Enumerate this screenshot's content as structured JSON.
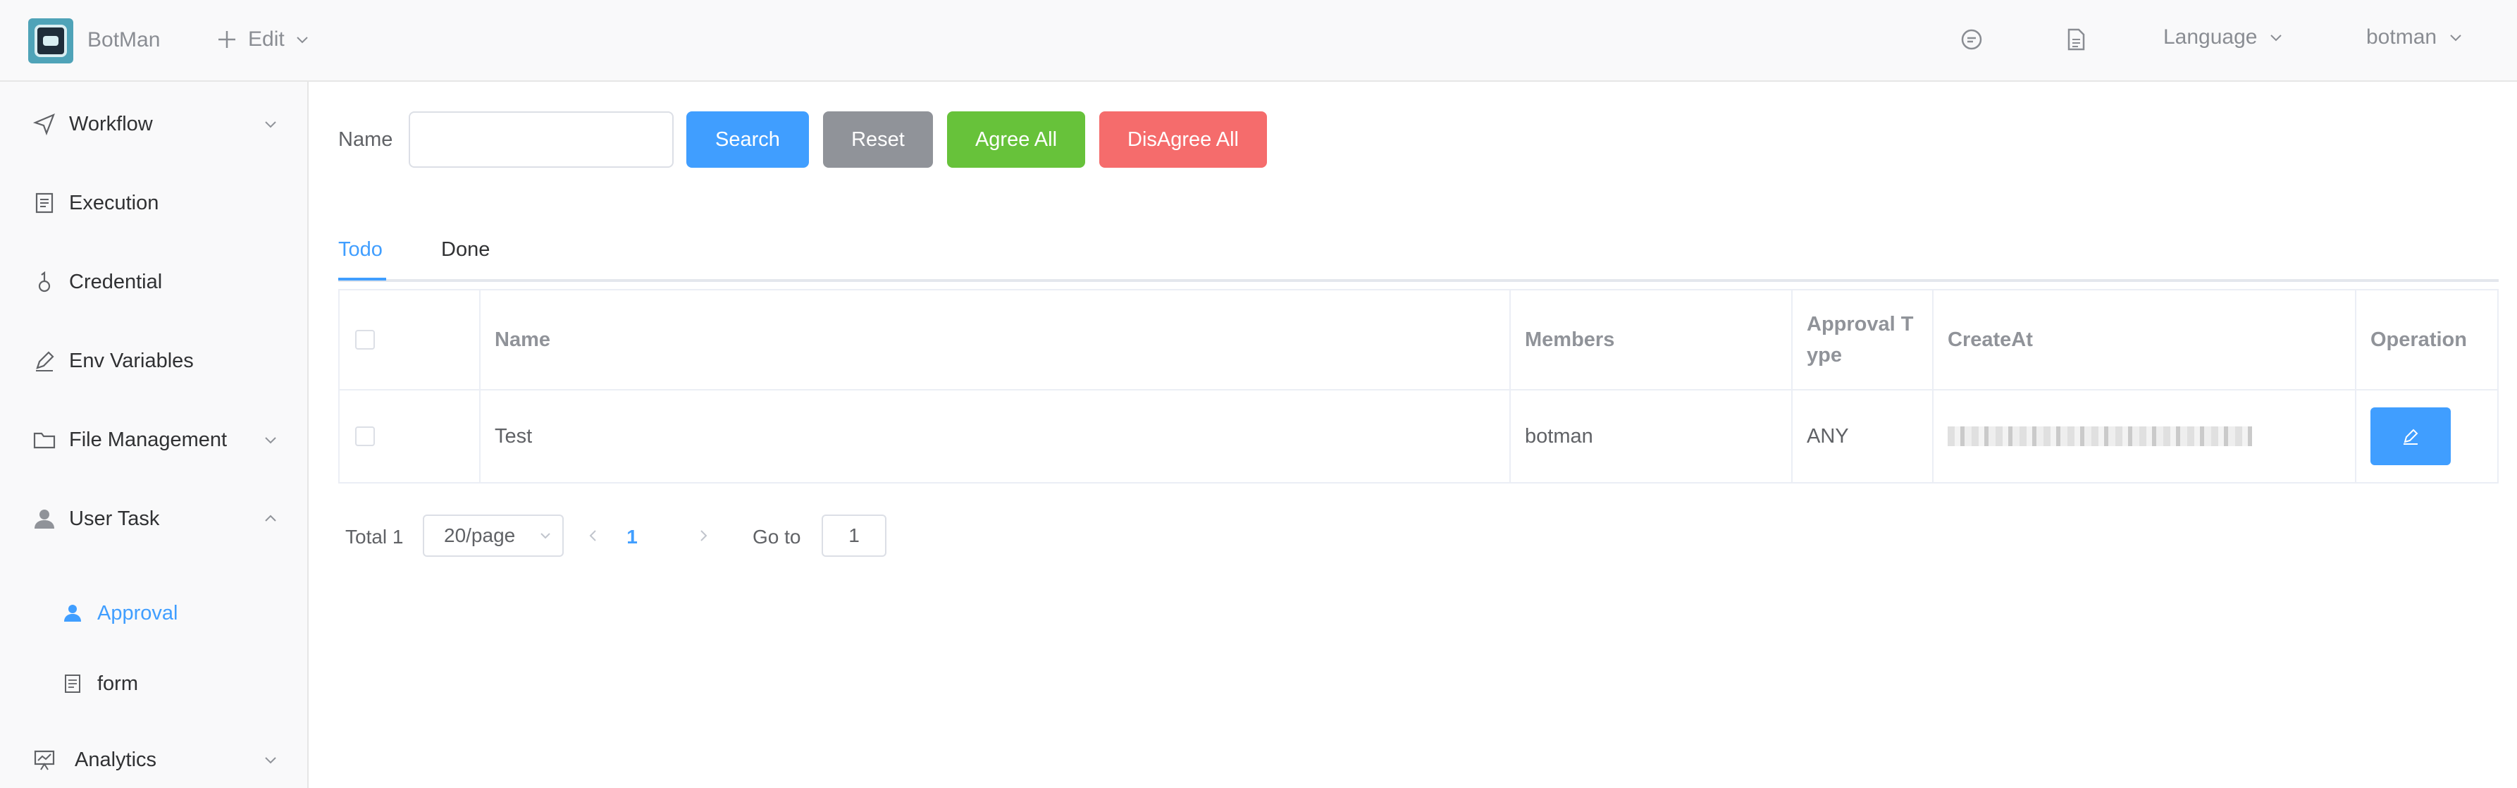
{
  "header": {
    "app_name": "BotMan",
    "edit_label": "Edit",
    "language_label": "Language",
    "user_label": "botman"
  },
  "sidebar": {
    "items": [
      {
        "label": "Workflow",
        "icon": "send-icon"
      },
      {
        "label": "Execution",
        "icon": "document-icon"
      },
      {
        "label": "Credential",
        "icon": "key-icon"
      },
      {
        "label": "Env Variables",
        "icon": "edit-icon"
      },
      {
        "label": "File Management",
        "icon": "folder-icon"
      },
      {
        "label": "User Task",
        "icon": "user-icon"
      }
    ],
    "sub_items": [
      {
        "label": "Approval",
        "icon": "user-icon",
        "active": true
      },
      {
        "label": "form",
        "icon": "document-icon",
        "active": false
      }
    ],
    "analytics_label": "Analytics"
  },
  "filter": {
    "name_label": "Name",
    "name_value": "",
    "search_label": "Search",
    "reset_label": "Reset",
    "agree_all_label": "Agree All",
    "disagree_all_label": "DisAgree All"
  },
  "tabs": [
    {
      "label": "Todo",
      "active": true
    },
    {
      "label": "Done",
      "active": false
    }
  ],
  "table": {
    "columns": [
      "Name",
      "Members",
      "Approval T ype",
      "CreateAt",
      "Operation"
    ],
    "rows": [
      {
        "name": "Test",
        "members": "botman",
        "approval_type": "ANY",
        "create_at": ""
      }
    ]
  },
  "pagination": {
    "total_label": "Total 1",
    "page_size": "20/page",
    "current_page": "1",
    "goto_label": "Go to",
    "goto_value": "1"
  },
  "colors": {
    "primary": "#409eff",
    "info": "#909399",
    "success": "#67c23a",
    "danger": "#f56c6c"
  }
}
